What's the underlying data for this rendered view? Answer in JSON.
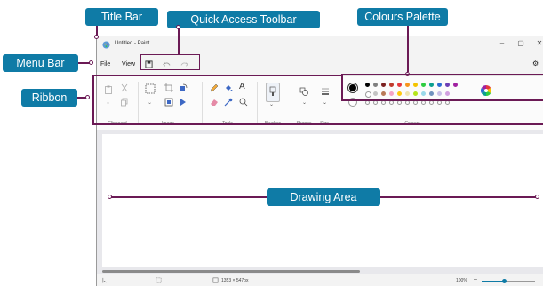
{
  "window": {
    "title": "Untitled - Paint",
    "minimize_glyph": "–",
    "maximize_glyph": "▢",
    "close_glyph": "✕",
    "account_glyph": "⚙"
  },
  "menu": {
    "file": "File",
    "view": "View"
  },
  "ribbon": {
    "groups": {
      "clipboard": "Clipboard",
      "image": "Image",
      "tools": "Tools",
      "brushes": "Brushes",
      "shapes": "Shapes",
      "size": "Size",
      "colours": "Colours"
    }
  },
  "palette": {
    "row1": [
      "#000000",
      "#7f7f7f",
      "#7b1f1f",
      "#c0392b",
      "#e5373d",
      "#f7941d",
      "#f5c400",
      "#2ecc40",
      "#0a9f8f",
      "#2d6bd1",
      "#6c3fb5",
      "#a020a0"
    ],
    "row2": [
      "#ffffff",
      "#c3c3c3",
      "#b97a57",
      "#f5a3c7",
      "#ffc90e",
      "#efe4b0",
      "#b5e61d",
      "#99d9ea",
      "#7092be",
      "#c8bfe7",
      "#d2a0e0"
    ],
    "primary": "#000000",
    "secondary": "#ffffff"
  },
  "status": {
    "canvas_size": "1353 × 547px",
    "zoom": "100%"
  },
  "callouts": {
    "title_bar": "Title Bar",
    "quick_access_toolbar": "Quick Access Toolbar",
    "colours_palette": "Colours Palette",
    "menu_bar": "Menu Bar",
    "ribbon": "Ribbon",
    "drawing_area": "Drawing Area"
  },
  "colors": {
    "callout_bg": "#0f7ba6",
    "leader_line": "#6b1a55"
  }
}
